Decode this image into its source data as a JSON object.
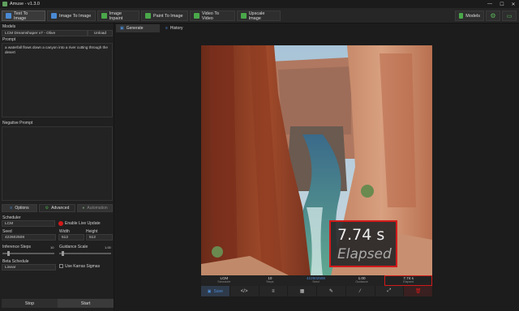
{
  "window": {
    "title": "Amuse - v1.3.0",
    "minimize": "—",
    "maximize": "☐",
    "close": "✕"
  },
  "toolbar": {
    "tabs": [
      {
        "label": "Text To Image",
        "color": "#4a8ad4"
      },
      {
        "label": "Image To Image",
        "color": "#4a8ad4"
      },
      {
        "label": "Image Inpaint",
        "color": "#4aa84a"
      },
      {
        "label": "Paint To Image",
        "color": "#4aa84a"
      },
      {
        "label": "Video To Video",
        "color": "#4aa84a"
      },
      {
        "label": "Upscale Image",
        "color": "#4aa84a"
      }
    ],
    "models_label": "Models"
  },
  "left": {
    "models_heading": "Models",
    "model_value": "LCM Dreamshaper v7 - Olive",
    "unload_label": "Unload",
    "prompt_heading": "Prompt",
    "prompt_text": "a waterfall flows down a canyon into a river cutting through the desert",
    "negative_heading": "Negative Prompt",
    "negative_text": "",
    "tabs": {
      "options": "Options",
      "advanced": "Advanced",
      "automation": "Automation"
    },
    "scheduler_label": "Scheduler",
    "scheduler_value": "LCM",
    "live_update_label": "Enable Live Update",
    "seed_label": "Seed",
    "seed_value": "422602508",
    "width_label": "Width",
    "width_value": "512",
    "height_label": "Height",
    "height_value": "512",
    "inference_label": "Inference Steps",
    "inference_value": "10",
    "inference_fraction": 0.1,
    "guidance_label": "Guidance Scale",
    "guidance_value": "1.00",
    "guidance_fraction": 0.05,
    "beta_label": "Beta Schedule",
    "beta_value": "Linear",
    "karras_label": "Use Karras Sigmas",
    "stop_label": "Stop",
    "start_label": "Start"
  },
  "right": {
    "tab_generate": "Generate",
    "tab_history": "History",
    "info": [
      {
        "value": "LCM",
        "key": "Scheduler"
      },
      {
        "value": "10",
        "key": "Steps"
      },
      {
        "value": "422602508",
        "key": "Seed"
      },
      {
        "value": "1.00",
        "key": "Guidance"
      },
      {
        "value": "7.74 s",
        "key": "Elapsed"
      }
    ],
    "save_label": "Save",
    "elapsed_value": "7.74 s",
    "elapsed_label": "Elapsed"
  }
}
